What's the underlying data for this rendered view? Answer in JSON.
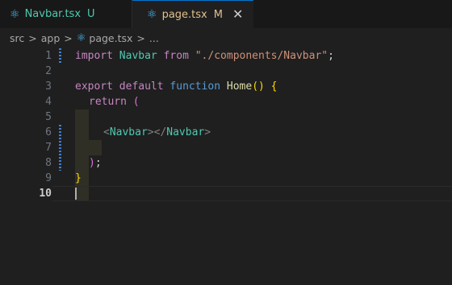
{
  "tabs": [
    {
      "icon": "react-icon",
      "name": "Navbar.tsx",
      "status": "U",
      "active": false
    },
    {
      "icon": "react-icon",
      "name": "page.tsx",
      "status": "M",
      "active": true,
      "close": "✕"
    }
  ],
  "breadcrumb": {
    "items": [
      "src",
      "app",
      "page.tsx",
      "..."
    ],
    "separator": ">"
  },
  "editor": {
    "active_line": "10",
    "lines": [
      {
        "n": "1"
      },
      {
        "n": "2"
      },
      {
        "n": "3"
      },
      {
        "n": "4"
      },
      {
        "n": "5"
      },
      {
        "n": "6"
      },
      {
        "n": "7"
      },
      {
        "n": "8"
      },
      {
        "n": "9"
      },
      {
        "n": "10"
      }
    ],
    "code": {
      "l1": {
        "import": "import",
        "name": "Navbar",
        "from": "from",
        "path": "\"./components/Navbar\"",
        "semi": ";"
      },
      "l3": {
        "export": "export",
        "default": "default",
        "function": "function",
        "name": "Home",
        "parens": "()",
        "brace": "{"
      },
      "l4": {
        "return": "return",
        "paren": "("
      },
      "l6": {
        "open": "<",
        "tag1": "Navbar",
        "mid": "></",
        "tag2": "Navbar",
        "close": ">"
      },
      "l8": {
        "paren": ")",
        "semi": ";"
      },
      "l9": {
        "brace": "}"
      }
    }
  },
  "colors": {
    "accent": "#0078d4",
    "modified": "#e2c08d",
    "untracked": "#4ec9b0"
  }
}
